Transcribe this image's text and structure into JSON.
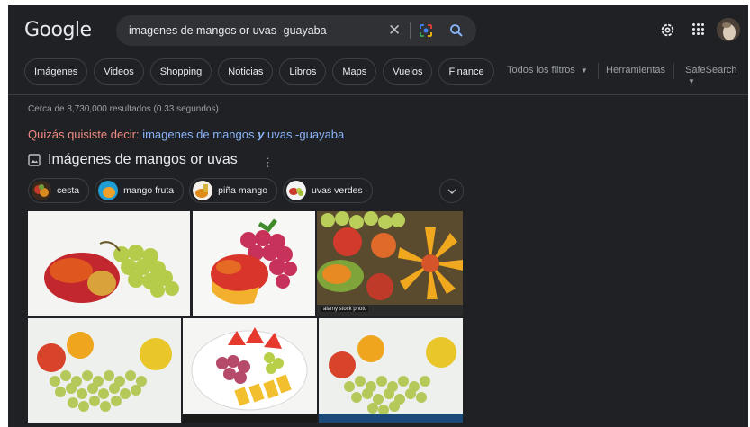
{
  "header": {
    "logo": "Google",
    "search_query": "imagenes de mangos or uvas -guayaba"
  },
  "nav": {
    "chips": [
      "Imágenes",
      "Videos",
      "Shopping",
      "Noticias",
      "Libros",
      "Maps",
      "Vuelos",
      "Finance"
    ],
    "all_filters": "Todos los filtros",
    "tools": "Herramientas",
    "safesearch": "SafeSearch"
  },
  "results": {
    "stats": "Cerca de 8,730,000 resultados (0.33 segundos)",
    "did_you_mean_label": "Quizás quisiste decir:",
    "suggestion_pre": "imagenes de mangos",
    "suggestion_bold": "y",
    "suggestion_post": "uvas -guayaba"
  },
  "images_section": {
    "title": "Imágenes de mangos or uvas",
    "filters": [
      "cesta",
      "mango fruta",
      "piña mango",
      "uvas verdes"
    ],
    "watermark": "alamy stock photo"
  },
  "colors": {
    "background": "#202124",
    "link": "#8ab4f8",
    "did_you_mean": "#f28b82",
    "text": "#e8eaed"
  }
}
